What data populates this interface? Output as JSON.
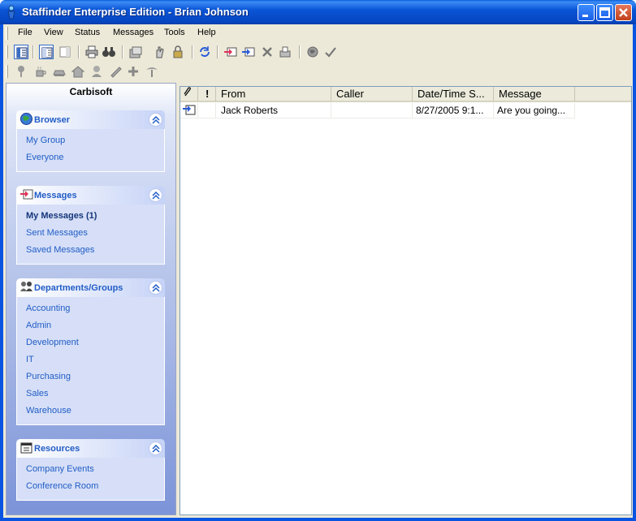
{
  "window": {
    "title": "Staffinder Enterprise Edition - Brian Johnson"
  },
  "menu": [
    "File",
    "View",
    "Status",
    "Messages",
    "Tools",
    "Help"
  ],
  "sidebar": {
    "brand": "Carbisoft",
    "panels": [
      {
        "title": "Browser",
        "icon": "globe-icon",
        "items": [
          "My Group",
          "Everyone"
        ]
      },
      {
        "title": "Messages",
        "icon": "message-icon",
        "items": [
          "My Messages (1)",
          "Sent Messages",
          "Saved Messages"
        ]
      },
      {
        "title": "Departments/Groups",
        "icon": "group-icon",
        "items": [
          "Accounting",
          "Admin",
          "Development",
          "IT",
          "Purchasing",
          "Sales",
          "Warehouse"
        ]
      },
      {
        "title": "Resources",
        "icon": "calendar-icon",
        "items": [
          "Company Events",
          "Conference Room"
        ]
      }
    ]
  },
  "list": {
    "columns": [
      "",
      "!",
      "From",
      "Caller",
      "Date/Time S...",
      "Message"
    ],
    "rows": [
      {
        "icon": "message-icon",
        "priority": "",
        "from": "Jack Roberts",
        "caller": "",
        "datetime": "8/27/2005 9:1...",
        "message": "Are you going..."
      }
    ]
  },
  "colors": {
    "title_bar": "#0a55d6",
    "panel_text": "#215dc6",
    "sidebar_gradient_end": "#7b93d8"
  }
}
